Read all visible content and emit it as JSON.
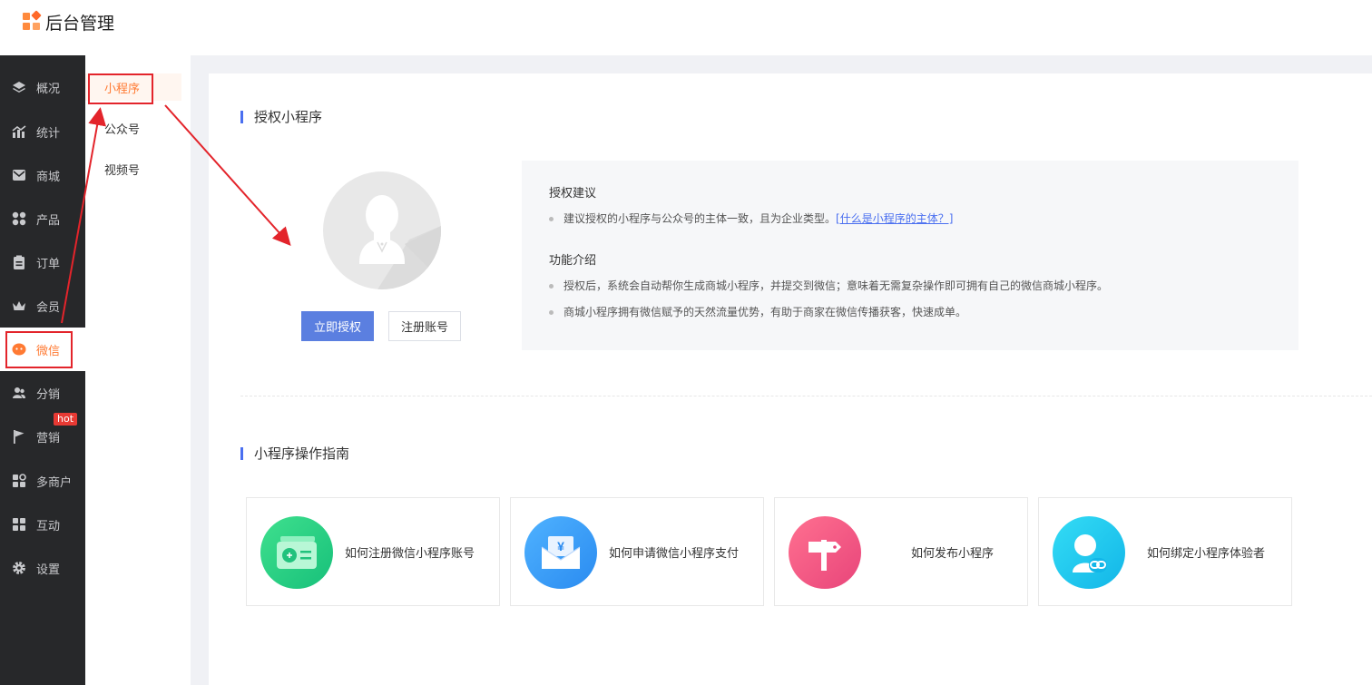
{
  "app": {
    "title": "后台管理"
  },
  "sidebar": {
    "items": [
      {
        "label": "概况",
        "icon": "layers-icon"
      },
      {
        "label": "统计",
        "icon": "chart-icon"
      },
      {
        "label": "商城",
        "icon": "mail-icon"
      },
      {
        "label": "产品",
        "icon": "grid-icon"
      },
      {
        "label": "订单",
        "icon": "clipboard-icon"
      },
      {
        "label": "会员",
        "icon": "crown-icon"
      },
      {
        "label": "微信",
        "icon": "wechat-icon",
        "active": true
      },
      {
        "label": "分销",
        "icon": "users-icon"
      },
      {
        "label": "营销",
        "icon": "flag-icon",
        "badge": "hot"
      },
      {
        "label": "多商户",
        "icon": "store-icon"
      },
      {
        "label": "互动",
        "icon": "apps-icon"
      },
      {
        "label": "设置",
        "icon": "gear-icon"
      }
    ]
  },
  "subnav": {
    "items": [
      {
        "label": "小程序",
        "active": true
      },
      {
        "label": "公众号"
      },
      {
        "label": "视频号"
      }
    ]
  },
  "auth": {
    "title": "授权小程序",
    "authorize_button": "立即授权",
    "register_button": "注册账号",
    "tips": {
      "suggest_title": "授权建议",
      "suggest_text": "建议授权的小程序与公众号的主体一致，且为企业类型。",
      "suggest_link": "[什么是小程序的主体？]",
      "intro_title": "功能介绍",
      "intro_items": [
        "授权后，系统会自动帮你生成商城小程序，并提交到微信；意味着无需复杂操作即可拥有自己的微信商城小程序。",
        "商城小程序拥有微信赋予的天然流量优势，有助于商家在微信传播获客，快速成单。"
      ]
    }
  },
  "guide": {
    "title": "小程序操作指南",
    "cards": [
      {
        "label": "如何注册微信小程序账号",
        "icon": "register-card-icon",
        "color": "#2ecf86"
      },
      {
        "label": "如何申请微信小程序支付",
        "icon": "payment-envelope-icon",
        "color": "#3a9ef5"
      },
      {
        "label": "如何发布小程序",
        "icon": "signpost-icon",
        "color": "#f05a7e"
      },
      {
        "label": "如何绑定小程序体验者",
        "icon": "user-link-icon",
        "color": "#1ec8f0"
      }
    ]
  },
  "colors": {
    "accent": "#ff7a33",
    "primary": "#5b7fe0",
    "sidebar_bg": "#27282a",
    "annotation": "#e3242b"
  }
}
